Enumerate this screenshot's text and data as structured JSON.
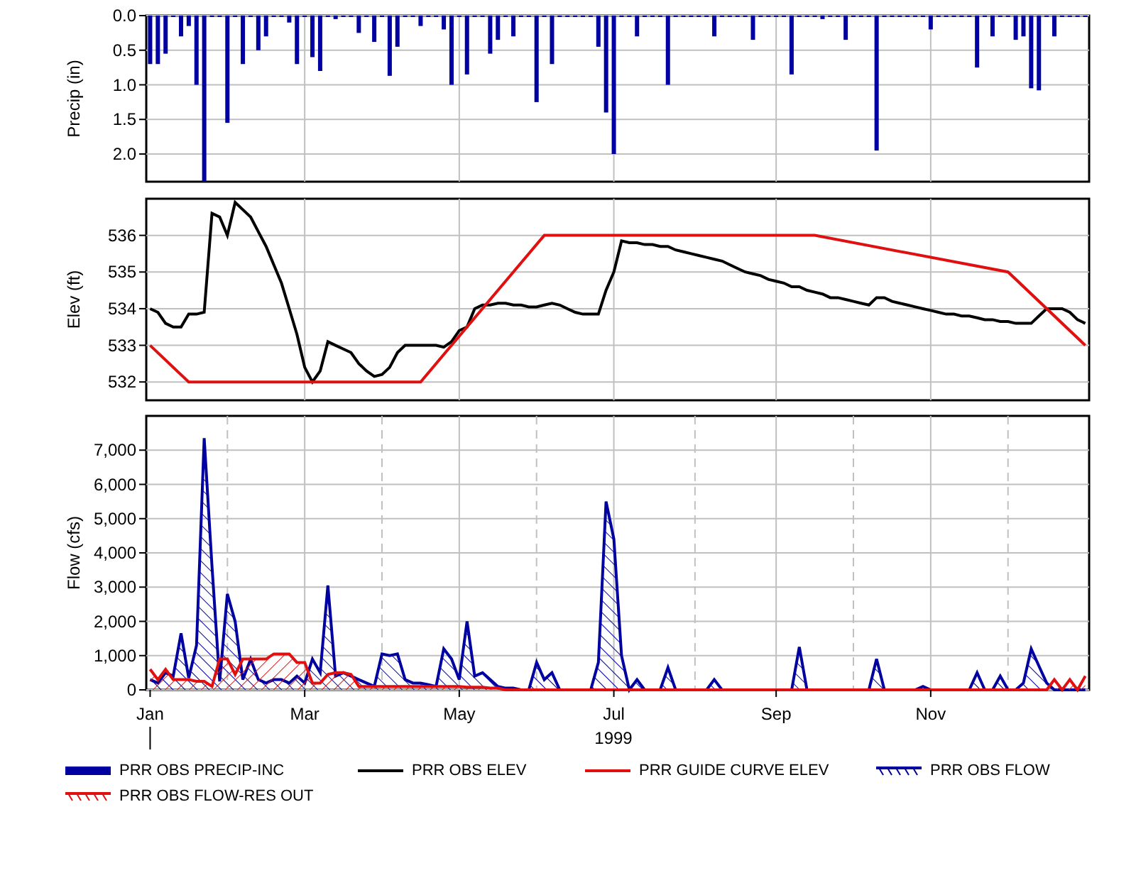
{
  "panels": [
    {
      "chart_data": {
        "type": "bar",
        "grid": true,
        "ylabel": "Precip (in)",
        "ylim": [
          2.4,
          0
        ],
        "yticks": [
          {
            "value": 0,
            "label": "0.0"
          },
          {
            "value": 0.5,
            "label": "0.5"
          },
          {
            "value": 1,
            "label": "1.0"
          },
          {
            "value": 1.5,
            "label": "1.5"
          },
          {
            "value": 2,
            "label": "2.0"
          }
        ],
        "series": [
          {
            "name": "PRR OBS PRECIP-INC",
            "color": "#0000a0",
            "values": [
              0.7,
              0.7,
              0.55,
              0,
              0.3,
              0.15,
              1.0,
              2.4,
              0,
              0,
              1.55,
              0,
              0.7,
              0,
              0.5,
              0.3,
              0,
              0,
              0.1,
              0.7,
              0,
              0.6,
              0.8,
              0,
              0.05,
              0,
              0,
              0.25,
              0,
              0.38,
              0,
              0.87,
              0.45,
              0,
              0,
              0.15,
              0,
              0,
              0.2,
              1.0,
              0,
              0.85,
              0,
              0,
              0.55,
              0.35,
              0,
              0.3,
              0,
              0,
              1.25,
              0,
              0.7,
              0,
              0,
              0,
              0,
              0,
              0.45,
              1.4,
              2.0,
              0,
              0,
              0.3,
              0,
              0,
              0,
              1.0,
              0,
              0,
              0,
              0,
              0,
              0.3,
              0,
              0,
              0,
              0,
              0.35,
              0,
              0,
              0,
              0,
              0.85,
              0,
              0,
              0,
              0.05,
              0,
              0,
              0.35,
              0,
              0,
              0,
              1.95,
              0,
              0,
              0,
              0,
              0,
              0,
              0.2,
              0,
              0,
              0,
              0,
              0,
              0.75,
              0,
              0.3,
              0,
              0,
              0.35,
              0.3,
              1.05,
              1.08,
              0,
              0.3,
              0,
              0,
              0,
              0
            ]
          }
        ]
      }
    },
    {
      "chart_data": {
        "type": "line",
        "grid": true,
        "ylabel": "Elev (ft)",
        "ylim": [
          531.5,
          537
        ],
        "yticks": [
          532,
          533,
          534,
          535,
          536
        ],
        "series": [
          {
            "name": "PRR OBS ELEV",
            "color": "#000000",
            "values": [
              534.0,
              533.9,
              533.6,
              533.5,
              533.5,
              533.85,
              533.85,
              533.9,
              536.6,
              536.5,
              536.0,
              536.9,
              536.7,
              536.5,
              536.1,
              535.7,
              535.2,
              534.7,
              534.0,
              533.3,
              532.4,
              532.0,
              532.3,
              533.1,
              533.0,
              532.9,
              532.8,
              532.5,
              532.3,
              532.15,
              532.2,
              532.4,
              532.8,
              533.0,
              533.0,
              533.0,
              533.0,
              533.0,
              532.95,
              533.1,
              533.4,
              533.5,
              534.0,
              534.1,
              534.1,
              534.15,
              534.15,
              534.1,
              534.1,
              534.05,
              534.05,
              534.1,
              534.15,
              534.1,
              534.0,
              533.9,
              533.85,
              533.85,
              533.85,
              534.5,
              535.0,
              535.85,
              535.8,
              535.8,
              535.75,
              535.75,
              535.7,
              535.7,
              535.6,
              535.55,
              535.5,
              535.45,
              535.4,
              535.35,
              535.3,
              535.2,
              535.1,
              535.0,
              534.95,
              534.9,
              534.8,
              534.75,
              534.7,
              534.6,
              534.6,
              534.5,
              534.45,
              534.4,
              534.3,
              534.3,
              534.25,
              534.2,
              534.15,
              534.1,
              534.3,
              534.3,
              534.2,
              534.15,
              534.1,
              534.05,
              534.0,
              533.95,
              533.9,
              533.85,
              533.85,
              533.8,
              533.8,
              533.75,
              533.7,
              533.7,
              533.65,
              533.65,
              533.6,
              533.6,
              533.6,
              533.8,
              534.0,
              534.0,
              534.0,
              533.9,
              533.7,
              533.6
            ]
          },
          {
            "name": "PRR GUIDE CURVE ELEV",
            "color": "#e01010",
            "values": [
              533.0,
              null,
              null,
              null,
              null,
              532.0,
              null,
              null,
              null,
              null,
              null,
              null,
              null,
              null,
              null,
              null,
              null,
              null,
              null,
              null,
              null,
              null,
              null,
              null,
              null,
              null,
              null,
              null,
              null,
              null,
              null,
              null,
              null,
              null,
              null,
              532.0,
              null,
              null,
              null,
              null,
              null,
              null,
              null,
              null,
              null,
              null,
              null,
              null,
              null,
              null,
              null,
              536.0,
              null,
              null,
              null,
              null,
              null,
              null,
              null,
              null,
              null,
              null,
              null,
              null,
              null,
              null,
              null,
              null,
              null,
              null,
              null,
              null,
              null,
              null,
              null,
              null,
              null,
              null,
              null,
              null,
              null,
              null,
              null,
              null,
              null,
              null,
              536.0,
              null,
              null,
              null,
              null,
              null,
              null,
              null,
              null,
              null,
              null,
              null,
              null,
              null,
              null,
              null,
              null,
              null,
              null,
              null,
              null,
              null,
              null,
              null,
              null,
              535.0,
              null,
              null,
              null,
              null,
              null,
              null,
              null,
              null,
              null,
              533.0
            ]
          }
        ]
      }
    },
    {
      "chart_data": {
        "type": "area",
        "grid": true,
        "ylabel": "Flow (cfs)",
        "xlabel": "1999",
        "ylim": [
          0,
          8000
        ],
        "yticks": [
          {
            "value": 0,
            "label": "0"
          },
          {
            "value": 1000,
            "label": "1,000"
          },
          {
            "value": 2000,
            "label": "2,000"
          },
          {
            "value": 3000,
            "label": "3,000"
          },
          {
            "value": 4000,
            "label": "4,000"
          },
          {
            "value": 5000,
            "label": "5,000"
          },
          {
            "value": 6000,
            "label": "6,000"
          },
          {
            "value": 7000,
            "label": "7,000"
          }
        ],
        "categories": [
          "Jan",
          null,
          null,
          null,
          null,
          null,
          null,
          null,
          null,
          null,
          null,
          null,
          null,
          null,
          null,
          null,
          null,
          null,
          null,
          null,
          "Mar",
          null,
          null,
          null,
          null,
          null,
          null,
          null,
          null,
          null,
          null,
          null,
          null,
          null,
          null,
          null,
          null,
          null,
          null,
          null,
          "May",
          null,
          null,
          null,
          null,
          null,
          null,
          null,
          null,
          null,
          null,
          null,
          null,
          null,
          null,
          null,
          null,
          null,
          null,
          null,
          "Jul",
          null,
          null,
          null,
          null,
          null,
          null,
          null,
          null,
          null,
          null,
          null,
          null,
          null,
          null,
          null,
          null,
          null,
          null,
          null,
          null,
          "Sep",
          null,
          null,
          null,
          null,
          null,
          null,
          null,
          null,
          null,
          null,
          null,
          null,
          null,
          null,
          null,
          null,
          null,
          null,
          null,
          "Nov",
          null,
          null,
          null,
          null,
          null,
          null,
          null,
          null,
          null,
          null,
          null,
          null,
          null,
          null,
          null,
          null,
          null,
          null,
          null,
          null
        ],
        "series": [
          {
            "name": "PRR OBS FLOW",
            "color": "#0000a0",
            "values": [
              300,
              200,
              500,
              400,
              1650,
              350,
              1300,
              7350,
              3600,
              250,
              2800,
              2000,
              300,
              900,
              300,
              200,
              300,
              300,
              200,
              400,
              200,
              900,
              500,
              3050,
              400,
              500,
              400,
              300,
              200,
              100,
              1050,
              1000,
              1050,
              300,
              200,
              200,
              150,
              100,
              1200,
              900,
              300,
              2000,
              400,
              500,
              300,
              100,
              50,
              50,
              0,
              0,
              800,
              300,
              500,
              0,
              0,
              0,
              0,
              0,
              800,
              5500,
              4400,
              1000,
              0,
              300,
              0,
              0,
              0,
              650,
              0,
              0,
              0,
              0,
              0,
              300,
              0,
              0,
              0,
              0,
              0,
              0,
              0,
              0,
              0,
              0,
              1250,
              0,
              0,
              0,
              0,
              0,
              0,
              0,
              0,
              0,
              900,
              0,
              0,
              0,
              0,
              0,
              100,
              0,
              0,
              0,
              0,
              0,
              0,
              500,
              0,
              0,
              400,
              0,
              0,
              200,
              1200,
              700,
              200,
              0,
              0,
              0,
              0,
              0
            ]
          },
          {
            "name": "PRR OBS FLOW-RES OUT",
            "color": "#e01010",
            "values": [
              600,
              300,
              600,
              300,
              300,
              300,
              250,
              250,
              100,
              900,
              900,
              450,
              900,
              900,
              900,
              900,
              1050,
              1050,
              1050,
              800,
              800,
              200,
              200,
              450,
              500,
              500,
              450,
              100,
              100,
              100,
              100,
              100,
              100,
              100,
              100,
              100,
              100,
              100,
              100,
              100,
              100,
              80,
              80,
              80,
              50,
              50,
              0,
              0,
              0,
              0,
              0,
              0,
              0,
              0,
              0,
              0,
              0,
              0,
              0,
              0,
              0,
              0,
              0,
              0,
              0,
              0,
              0,
              0,
              0,
              0,
              0,
              0,
              0,
              0,
              0,
              0,
              0,
              0,
              0,
              0,
              0,
              0,
              0,
              0,
              0,
              0,
              0,
              0,
              0,
              0,
              0,
              0,
              0,
              0,
              0,
              0,
              0,
              0,
              0,
              0,
              0,
              0,
              0,
              0,
              0,
              0,
              0,
              0,
              0,
              0,
              0,
              0,
              0,
              0,
              0,
              0,
              0,
              300,
              0,
              300,
              0,
              400
            ]
          }
        ]
      }
    }
  ]
}
